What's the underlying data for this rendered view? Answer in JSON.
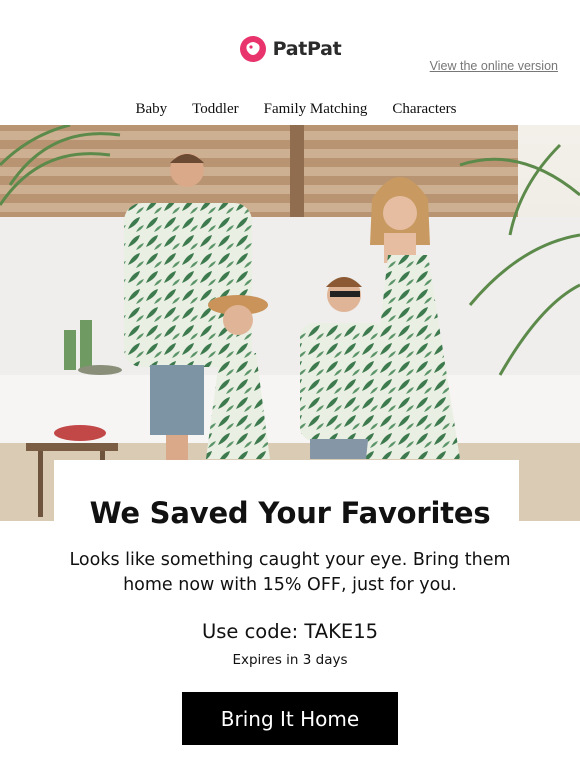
{
  "brand": {
    "name": "PatPat",
    "accent": "#e8336d"
  },
  "header": {
    "online_link": "View the online version"
  },
  "nav": {
    "items": [
      {
        "label": "Baby"
      },
      {
        "label": "Toddler"
      },
      {
        "label": "Family Matching"
      },
      {
        "label": "Characters"
      }
    ]
  },
  "hero": {
    "icon": "family-matching-outfits-photo"
  },
  "promo": {
    "headline": "We Saved Your Favorites",
    "body": "Looks like something caught your eye. Bring them home now with 15% OFF, just for you.",
    "code_line": "Use code: TAKE15",
    "expiry": "Expires in 3 days",
    "cta_label": "Bring It Home",
    "cta_color": "#000000"
  }
}
